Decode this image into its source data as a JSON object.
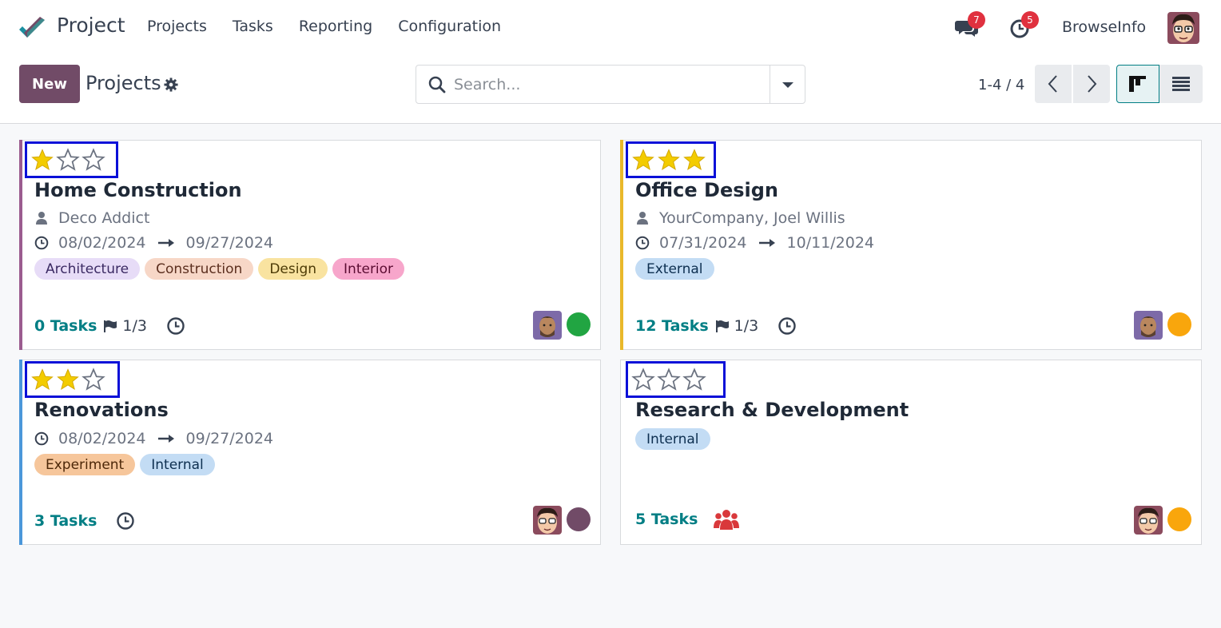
{
  "navbar": {
    "app_name": "Project",
    "menu": [
      "Projects",
      "Tasks",
      "Reporting",
      "Configuration"
    ],
    "messages_badge": "7",
    "activities_badge": "5",
    "company": "BrowseInfo"
  },
  "control_panel": {
    "new_label": "New",
    "title": "Projects",
    "search_placeholder": "Search...",
    "pager": "1-4 / 4"
  },
  "projects": [
    {
      "name": "Home Construction",
      "stars": 1,
      "customer": "Deco Addict",
      "date_start": "08/02/2024",
      "date_end": "09/27/2024",
      "tags": [
        {
          "label": "Architecture",
          "bg": "#e7dcf7",
          "fg": "#3b2a63"
        },
        {
          "label": "Construction",
          "bg": "#f7d7c7",
          "fg": "#5c2f1f"
        },
        {
          "label": "Design",
          "bg": "#f9e3a0",
          "fg": "#4d3b06"
        },
        {
          "label": "Interior",
          "bg": "#f7a6cb",
          "fg": "#5c0d33"
        }
      ],
      "tasks": "0 Tasks",
      "milestones": "1/3",
      "accent": "#9b5c8f",
      "status_color": "#21a542"
    },
    {
      "name": "Office Design",
      "stars": 3,
      "customer": "YourCompany, Joel Willis",
      "date_start": "07/31/2024",
      "date_end": "10/11/2024",
      "tags": [
        {
          "label": "External",
          "bg": "#c3dcf4",
          "fg": "#0d2f50"
        }
      ],
      "tasks": "12 Tasks",
      "milestones": "1/3",
      "accent": "#e9b82a",
      "status_color": "#f9a60c"
    },
    {
      "name": "Renovations",
      "stars": 2,
      "date_start": "08/02/2024",
      "date_end": "09/27/2024",
      "tags": [
        {
          "label": "Experiment",
          "bg": "#f6c69b",
          "fg": "#4d2809"
        },
        {
          "label": "Internal",
          "bg": "#c3dcf4",
          "fg": "#0d2f50"
        }
      ],
      "tasks": "3 Tasks",
      "accent": "#4b97da",
      "status_color": "#714b67"
    },
    {
      "name": "Research & Development",
      "stars": 0,
      "tags": [
        {
          "label": "Internal",
          "bg": "#c3dcf4",
          "fg": "#0d2f50"
        }
      ],
      "tasks": "5 Tasks",
      "accent": "",
      "status_color": "#f9a60c"
    }
  ],
  "colors": {
    "brand": "#714b67",
    "link": "#017e84",
    "star_filled": "#f3cc00",
    "star_outline": "#6b7280",
    "highlight_box": "#0a10d8"
  },
  "icons": [
    "logo-icon",
    "chat-icon",
    "clock-icon",
    "gear-icon",
    "search-icon",
    "caret-down-icon",
    "chevron-left-icon",
    "chevron-right-icon",
    "kanban-icon",
    "list-icon",
    "star-icon",
    "user-icon",
    "flag-icon",
    "people-icon"
  ]
}
